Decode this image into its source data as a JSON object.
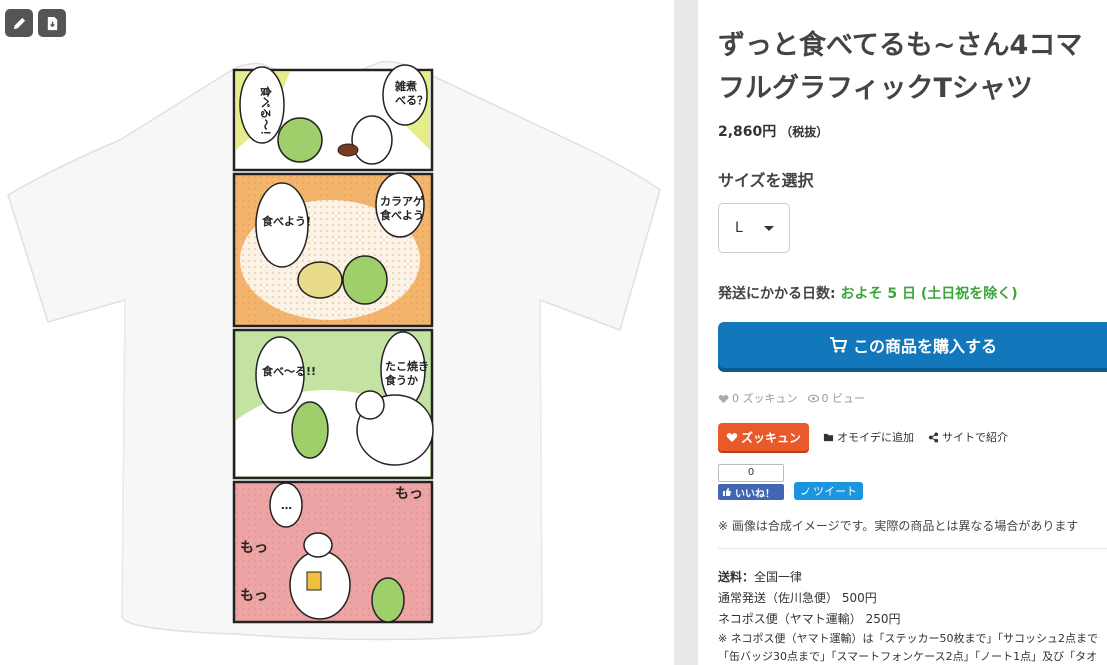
{
  "toolbar": {
    "edit_icon": "pencil-icon",
    "download_icon": "file-download-icon"
  },
  "product": {
    "title_line1": "ずっと食べてるも~さん4コマ",
    "title_line2": "フルグラフィックTシャツ",
    "price": "2,860円",
    "tax": "（税抜）",
    "size_label": "サイズを選択",
    "size_selected": "L",
    "ship_label": "発送にかかる日数:",
    "ship_value": "およそ 5 日 (土日祝を除く)",
    "buy_label": "この商品を購入する",
    "zukkyun_count": "0 ズッキュン",
    "view_count": "0 ビュー"
  },
  "actions": {
    "zukkyun": "ズッキュン",
    "omoide": "オモイデに追加",
    "share": "サイトで紹介"
  },
  "social": {
    "like_count": "0",
    "like_label": "いいね！",
    "tweet_label": "ツイート"
  },
  "note": "※ 画像は合成イメージです。実際の商品とは異なる場合があります",
  "shipping": {
    "label": "送料：",
    "label_value": "全国一律",
    "line1": "通常発送（佐川急便） 500円",
    "line2": "ネコポス便（ヤマト運輸） 250円",
    "line3": "※ ネコポス便（ヤマト運輸）は「ステッカー50枚まで」「サコッシュ2点まで",
    "line4": "「缶バッジ30点まで」「スマートフォンケース2点」「ノート1点」及び「タオ"
  },
  "comic": {
    "p1_a": "雑煮\nべる？",
    "p1_b": "食べる〜！",
    "p2_a": "カラアゲ\n食べよう",
    "p2_b": "食べよう！",
    "p3_a": "たこ焼き\n食うか",
    "p3_b": "食べ〜る!!",
    "p4_a": "…",
    "p4_b": "もっ",
    "p4_c": "もっ",
    "p4_d": "もっ"
  },
  "colors": {
    "buy": "#1277bb",
    "zukkyun": "#e85a2a",
    "ship_value": "#3aa63a"
  }
}
